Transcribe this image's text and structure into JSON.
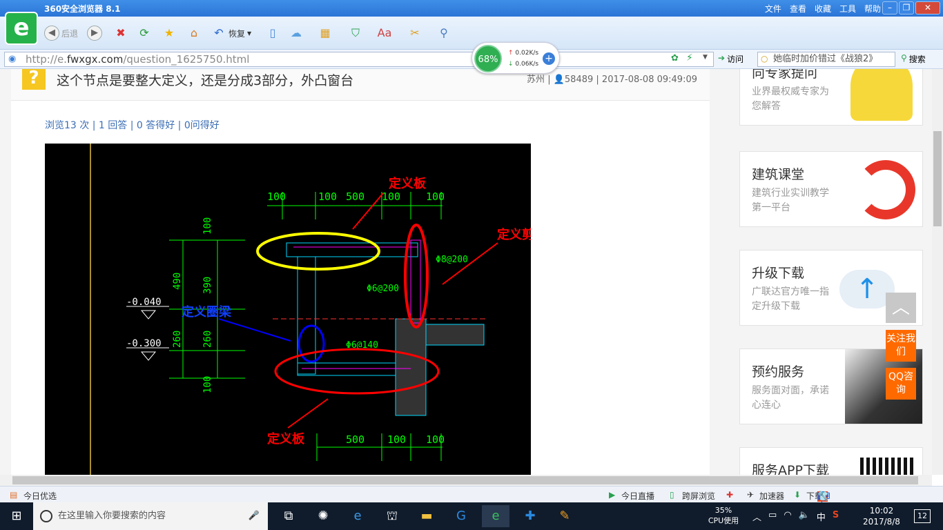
{
  "browser": {
    "title": "360安全浏览器 8.1",
    "menus": [
      "文件",
      "查看",
      "收藏",
      "工具",
      "帮助"
    ],
    "back_label": "后退",
    "restore_label": "恢复",
    "url_prefix": "http://e.",
    "url_domain": "fwxgx.com",
    "url_path": "/question_1625750.html",
    "visit_label": "访问",
    "search_value": "她临时加价错过《战狼2》",
    "search_label": "搜索"
  },
  "speed_widget": {
    "percent": "68%",
    "up": "0.02K/s",
    "down": "0.06K/s"
  },
  "question": {
    "title": "这个节点是要整大定义，还是分成3部分，外凸窗台",
    "location": "苏州",
    "user": "58489",
    "datetime": "2017-08-08 09:49:09",
    "stats": "浏览13 次 | 1 回答 | 0 答得好 | 0问得好"
  },
  "cad": {
    "dims_top": [
      "100",
      "100",
      "500",
      "100",
      "100"
    ],
    "dims_bottom": [
      "500",
      "100",
      "100"
    ],
    "dims_left": [
      "100",
      "490",
      "390",
      "260",
      "260",
      "100"
    ],
    "levels": [
      "-0.040",
      "-0.300"
    ],
    "rebar": [
      "Φ8@200",
      "Φ6@200",
      "Φ6@140"
    ],
    "label_board_top": "定义板",
    "label_wall": "定义剪力墙",
    "label_beam": "定义圈梁",
    "label_board_bottom": "定义板"
  },
  "sidebar": [
    {
      "title": "向专家提问",
      "desc": "业界最权威专家为您解答"
    },
    {
      "title": "建筑课堂",
      "desc": "建筑行业实训教学第一平台"
    },
    {
      "title": "升级下载",
      "desc": "广联达官方唯一指定升级下载"
    },
    {
      "title": "预约服务",
      "desc": "服务面对面，承诺心连心"
    },
    {
      "title": "服务APP下载",
      "desc": ""
    }
  ],
  "float_buttons": {
    "follow": "关注我们",
    "qq": "QQ咨询"
  },
  "statusbar": {
    "left": "今日优选",
    "live": "今日直播",
    "cross": "跨屏浏览",
    "accel": "加速器",
    "download": "下载"
  },
  "taskbar": {
    "search_placeholder": "在这里输入你要搜索的内容",
    "cpu_pct": "35%",
    "cpu_label": "CPU使用",
    "ime": "中",
    "time": "10:02",
    "date": "2017/8/8",
    "notif": "12"
  },
  "colors": {
    "titlebar": "#2a74d6",
    "accent_orange": "#ff6a00",
    "cad_green": "#00ff00",
    "annot_red": "#ff0000"
  }
}
